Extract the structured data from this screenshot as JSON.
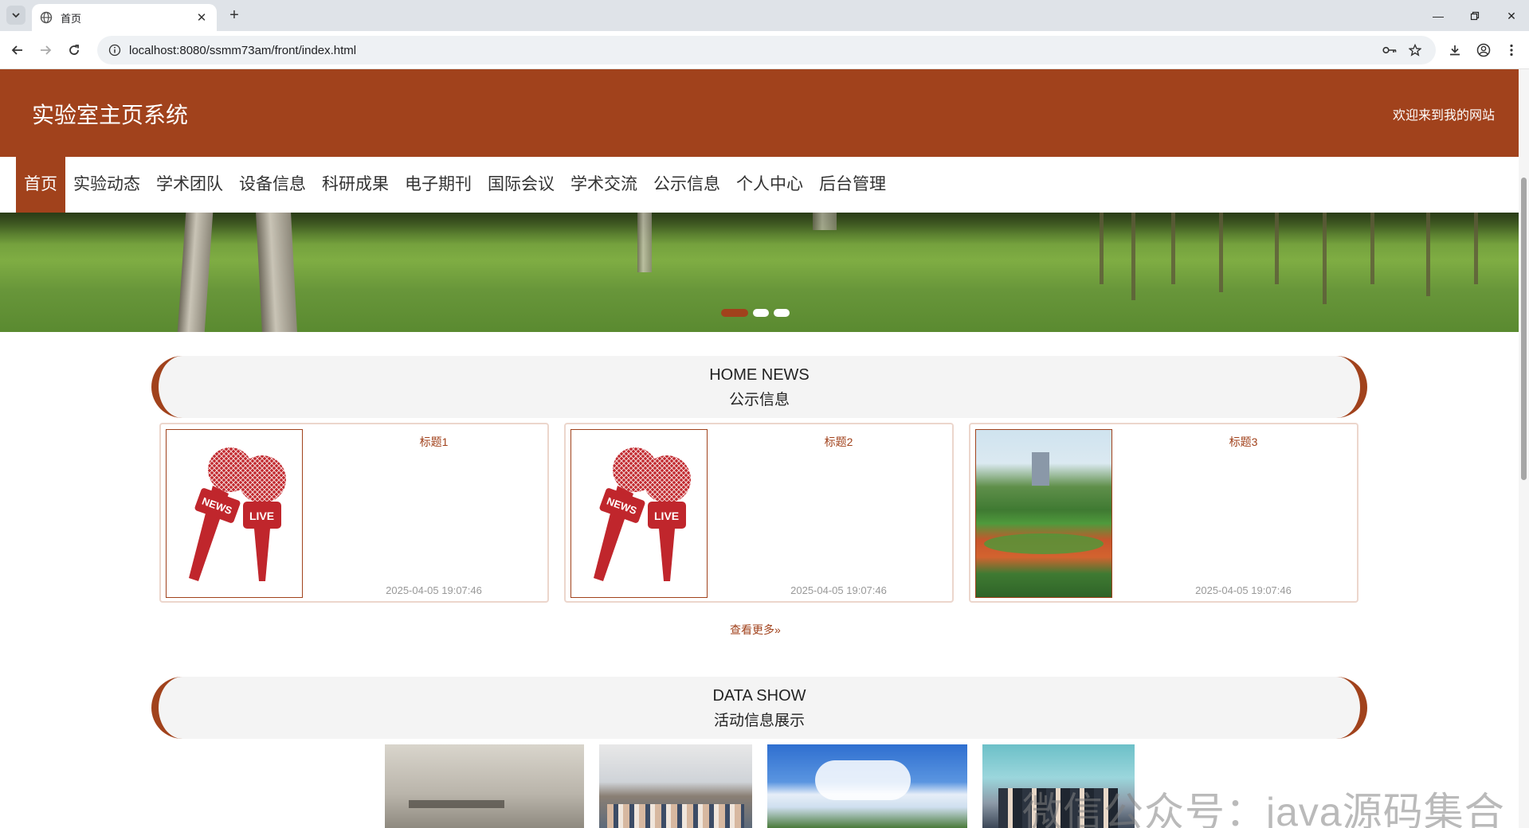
{
  "browser": {
    "tab_title": "首页",
    "url": "localhost:8080/ssmm73am/front/index.html"
  },
  "site": {
    "title": "实验室主页系统",
    "welcome": "欢迎来到我的网站"
  },
  "nav": {
    "items": [
      "首页",
      "实验动态",
      "学术团队",
      "设备信息",
      "科研成果",
      "电子期刊",
      "国际会议",
      "学术交流",
      "公示信息",
      "个人中心",
      "后台管理"
    ],
    "active_index": 0
  },
  "banner": {
    "slide_count": 3,
    "active_slide": 0
  },
  "news_section": {
    "title_en": "HOME NEWS",
    "title_cn": "公示信息",
    "cards": [
      {
        "title": "标题1",
        "date": "2025-04-05 19:07:46",
        "image": "news-live-microphones",
        "image_labels": [
          "NEWS",
          "LIVE"
        ]
      },
      {
        "title": "标题2",
        "date": "2025-04-05 19:07:46",
        "image": "news-live-microphones",
        "image_labels": [
          "NEWS",
          "LIVE"
        ]
      },
      {
        "title": "标题3",
        "date": "2025-04-05 19:07:46",
        "image": "campus-sports-field"
      }
    ],
    "more_label": "查看更多»"
  },
  "data_section": {
    "title_en": "DATA SHOW",
    "title_cn": "活动信息展示"
  },
  "watermark": "微信公众号：java源码集合",
  "colors": {
    "brand": "#a1421c",
    "header_text": "#ffffff",
    "card_border": "#ecd6cc"
  }
}
